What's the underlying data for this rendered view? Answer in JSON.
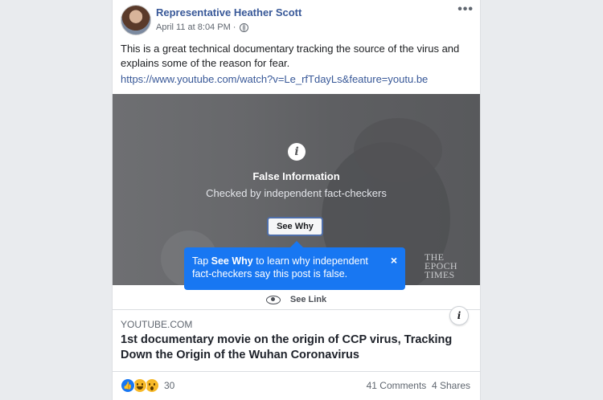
{
  "post": {
    "author": "Representative Heather Scott",
    "timestamp": "April 11 at 8:04 PM",
    "separator": "·",
    "privacy_icon": "globe-icon",
    "more_label": "•••",
    "text": "This is a great technical documentary tracking the source of the virus and explains some of the reason for fear.",
    "url": "https://www.youtube.com/watch?v=Le_rfTdayLs&feature=youtu.be"
  },
  "fact_check": {
    "info_glyph": "i",
    "title": "False Information",
    "subtitle": "Checked by independent fact-checkers",
    "see_why_label": "See Why",
    "watermark": [
      "THE",
      "EPOCH",
      "TIMES"
    ]
  },
  "tooltip": {
    "prefix": "Tap ",
    "bold": "See Why",
    "suffix": " to learn why independent fact-checkers say this post is false.",
    "close": "×",
    "color": "#1877f2"
  },
  "see_link": {
    "label": "See Link",
    "icon": "eye-icon"
  },
  "link_preview": {
    "info_glyph": "i",
    "domain": "YOUTUBE.COM",
    "title": "1st documentary movie on the origin of CCP virus, Tracking Down the Origin of the Wuhan Coronavirus"
  },
  "footer": {
    "reaction_icons": [
      "like-icon",
      "haha-icon",
      "wow-icon"
    ],
    "reaction_count": "30",
    "comments": "41 Comments",
    "shares": "4 Shares"
  },
  "colors": {
    "link": "#385898",
    "page_bg": "#e9ebee",
    "secondary_text": "#606770"
  }
}
